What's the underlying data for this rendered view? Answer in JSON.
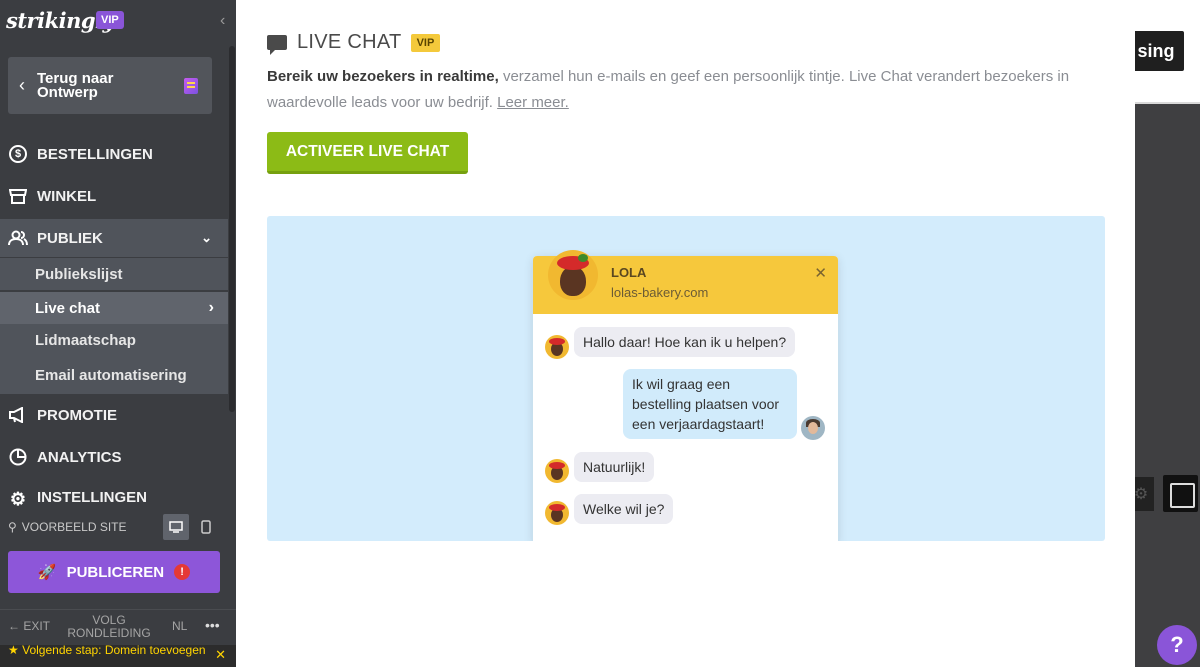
{
  "sidebar": {
    "logo": "strikingly",
    "vip": "VIP",
    "collapse_icon": "chevron-left",
    "back_label": "Terug naar Ontwerp",
    "nav": [
      {
        "label": "BESTELLINGEN",
        "icon": "dollar-circle"
      },
      {
        "label": "WINKEL",
        "icon": "store"
      },
      {
        "label": "PUBLIEK",
        "icon": "users",
        "expanded": true
      },
      {
        "label": "PROMOTIE",
        "icon": "megaphone"
      },
      {
        "label": "ANALYTICS",
        "icon": "pie-chart"
      },
      {
        "label": "INSTELLINGEN",
        "icon": "gear"
      }
    ],
    "subnav": [
      {
        "label": "Publiekslijst"
      },
      {
        "label": "Live chat",
        "active": true
      },
      {
        "label": "Lidmaatschap"
      },
      {
        "label": "Email automatisering"
      }
    ],
    "preview_label": "VOORBEELD SITE",
    "publish_label": "PUBLICEREN",
    "publish_alert": "!",
    "footer": {
      "exit": "EXIT",
      "tour": "VOLG RONDLEIDING",
      "lang": "NL",
      "more": "•••"
    },
    "next_step": "Volgende stap: Domein toevoegen",
    "next_close": "✕"
  },
  "modal": {
    "title": "LIVE CHAT",
    "vip": "VIP",
    "desc_bold": "Bereik uw bezoekers in realtime,",
    "desc_rest": " verzamel hun e-mails en geef een persoonlijk tintje. Live Chat verandert bezoekers in waardevolle leads voor uw bedrijf.",
    "learn_more": "Leer meer.",
    "activate_label": "ACTIVEER LIVE CHAT",
    "widget": {
      "name": "LOLA",
      "site": "lolas-bakery.com",
      "close": "✕",
      "messages": [
        {
          "from": "agent",
          "text": "Hallo daar! Hoe kan ik u helpen?"
        },
        {
          "from": "visitor",
          "text": "Ik wil graag een bestelling plaatsen voor een verjaardagstaart!"
        },
        {
          "from": "agent",
          "text": "Natuurlijk!"
        },
        {
          "from": "agent",
          "text": "Welke wil je?"
        }
      ]
    }
  },
  "editor": {
    "top_button": "sing",
    "help": "?"
  },
  "colors": {
    "accent_purple": "#8d56d9",
    "activate_green": "#8cbb16",
    "widget_yellow": "#f6c83c",
    "preview_blue": "#d3ecfc",
    "sidebar_bg": "#3b3d41"
  }
}
